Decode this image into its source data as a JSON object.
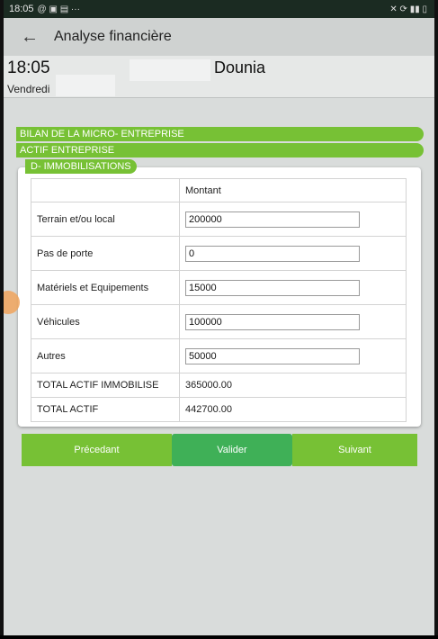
{
  "status_bar": {
    "time": "18:05",
    "icons_left": "@ ▣ ▤ ···",
    "icons_right": "✕ ⟳ ▮▮ ▯"
  },
  "app_bar": {
    "back_icon": "←",
    "title": "Analyse financière"
  },
  "header": {
    "time": "18:05",
    "day": "Vendredi",
    "user_name": "Dounia"
  },
  "sections": {
    "bilan": "BILAN DE LA MICRO- ENTREPRISE",
    "actif": "ACTIF ENTREPRISE",
    "immobilisations": "D- IMMOBILISATIONS"
  },
  "table": {
    "column_header": "Montant",
    "rows": [
      {
        "label": "Terrain et/ou local",
        "value": "200000"
      },
      {
        "label": "Pas de porte",
        "value": "0"
      },
      {
        "label": "Matériels et Equipements",
        "value": "15000"
      },
      {
        "label": "Véhicules",
        "value": "100000"
      },
      {
        "label": "Autres",
        "value": "50000"
      }
    ],
    "totals": [
      {
        "label": "TOTAL ACTIF IMMOBILISE",
        "value": "365000.00"
      },
      {
        "label": "TOTAL ACTIF",
        "value": "442700.00"
      }
    ]
  },
  "buttons": {
    "previous": "Précedant",
    "validate": "Valider",
    "next": "Suivant"
  },
  "colors": {
    "accent_green": "#77c135",
    "validate_green": "#3fb057"
  }
}
